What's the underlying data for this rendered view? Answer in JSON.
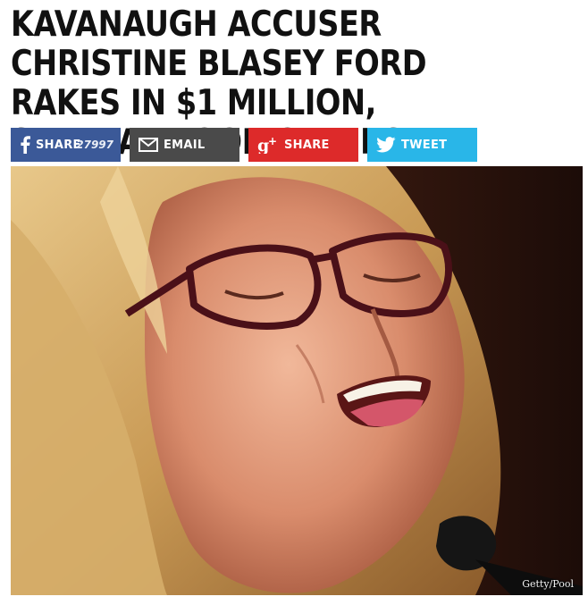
{
  "article": {
    "headline": "KAVANAUGH ACCUSER CHRISTINE BLASEY FORD RAKES IN $1 MILLION, SEVERAL BOOK OFFERS"
  },
  "share": {
    "facebook": {
      "label": "SHARE",
      "count": "27997",
      "icon": "facebook-icon",
      "color": "#3b5998"
    },
    "email": {
      "label": "EMAIL",
      "icon": "envelope-icon",
      "color": "#4a4a4a"
    },
    "googleplus": {
      "label": "SHARE",
      "icon": "google-plus-icon",
      "color": "#dd2a2a"
    },
    "twitter": {
      "label": "TWEET",
      "icon": "twitter-bird-icon",
      "color": "#29b6e8"
    }
  },
  "photo": {
    "credit": "Getty/Pool"
  }
}
